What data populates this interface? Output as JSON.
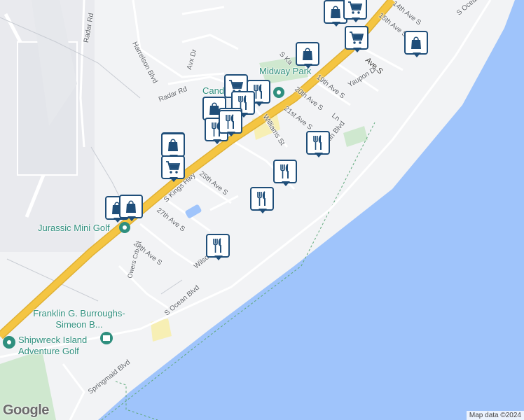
{
  "map": {
    "colors": {
      "water": "#9fc4fb",
      "land": "#f2f3f5",
      "highway": "#f4c542",
      "park": "#cfe8cf",
      "beach": "#f7efb4",
      "marker_border": "#1f4e79"
    },
    "road_labels": [
      "Radar Rd",
      "Harrelson Blvd",
      "Avx Dr",
      "Radar Rd",
      "S Kings Hwy",
      "25th Ave S",
      "27th Ave S",
      "29th Ave S",
      "Owers Crb Ct",
      "Wilson",
      "S Ocean Blvd",
      "S Ocean Blvd",
      "Springmaid Blvd",
      "Williams St",
      "21st Ave S",
      "20th Ave S",
      "19th Ave S",
      "Yaupon Dr",
      "15th Ave S",
      "14th Ave S",
      "S Ocean Blvd",
      "Ave S",
      "S Ka",
      "Ln"
    ],
    "poi_labels": [
      "Midway Park",
      "Cand",
      "Jurassic Mini Golf",
      "Franklin G. Burroughs-Simeon B...",
      "Shipwreck Island Adventure Golf"
    ],
    "markers": [
      {
        "icon": "shopping-bag-icon"
      },
      {
        "icon": "shopping-cart-icon"
      },
      {
        "icon": "shopping-cart-icon"
      },
      {
        "icon": "shopping-bag-icon"
      },
      {
        "icon": "shopping-bag-icon"
      },
      {
        "icon": "shopping-cart-icon"
      },
      {
        "icon": "restaurant-icon"
      },
      {
        "icon": "restaurant-icon"
      },
      {
        "icon": "shopping-bag-icon"
      },
      {
        "icon": "shopping-cart-icon"
      },
      {
        "icon": "restaurant-icon"
      },
      {
        "icon": "restaurant-icon"
      },
      {
        "icon": "shopping-bag-icon"
      },
      {
        "icon": "restaurant-icon"
      },
      {
        "icon": "shopping-bag-icon"
      },
      {
        "icon": "shopping-cart-icon"
      },
      {
        "icon": "restaurant-icon"
      },
      {
        "icon": "restaurant-icon"
      },
      {
        "icon": "shopping-bag-icon"
      },
      {
        "icon": "shopping-bag-icon"
      },
      {
        "icon": "restaurant-icon"
      }
    ],
    "attribution": "Map data ©2024",
    "logo": "Google"
  }
}
